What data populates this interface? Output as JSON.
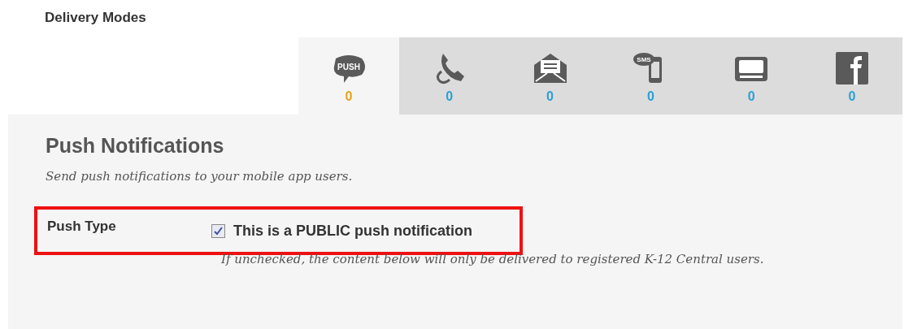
{
  "heading": "Delivery Modes",
  "tabs": [
    {
      "kind": "push",
      "icon_text": "PUSH",
      "count": "0",
      "selected": true
    },
    {
      "kind": "phone",
      "count": "0",
      "selected": false
    },
    {
      "kind": "email",
      "count": "0",
      "selected": false
    },
    {
      "kind": "sms",
      "icon_text": "SMS",
      "count": "0",
      "selected": false
    },
    {
      "kind": "display",
      "count": "0",
      "selected": false
    },
    {
      "kind": "facebook",
      "count": "0",
      "selected": false
    }
  ],
  "panel": {
    "title": "Push Notifications",
    "subtitle": "Send push notifications to your mobile app users.",
    "field": {
      "label": "Push Type",
      "checkbox_label": "This is a PUBLIC push notification",
      "checked": true,
      "highlighted": true
    },
    "hint": "If unchecked, the content below will only be delivered to registered K-12 Central users."
  }
}
